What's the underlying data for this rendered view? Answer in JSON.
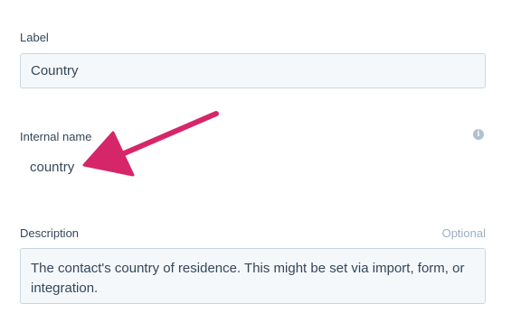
{
  "label_field": {
    "label": "Label",
    "value": "Country"
  },
  "internal_name": {
    "label": "Internal name",
    "value": "country",
    "info_icon": "info-icon"
  },
  "description_field": {
    "label": "Description",
    "optional": "Optional",
    "value": "The contact's country of residence. This might be set via import, form, or integration."
  },
  "colors": {
    "arrow": "#d6266a",
    "text": "#33475b",
    "input_bg": "#f5f8fa",
    "input_border": "#cbd6e2",
    "muted": "#99afc4"
  }
}
